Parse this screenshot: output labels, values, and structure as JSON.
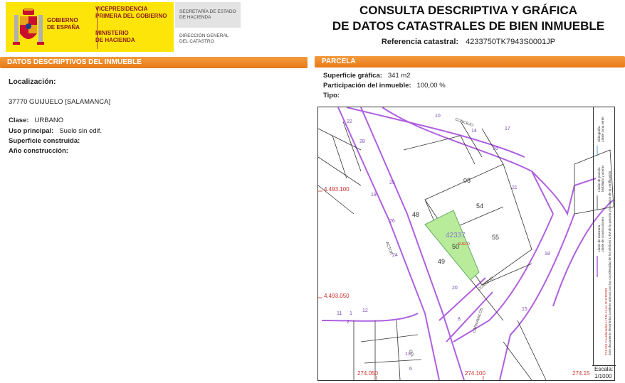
{
  "header": {
    "gov": [
      "GOBIERNO",
      "DE ESPAÑA"
    ],
    "vice": [
      "VICEPRESIDENCIA",
      "PRIMERA DEL GOBIERNO"
    ],
    "ministerio": [
      "MINISTERIO",
      "DE HACIENDA"
    ],
    "secretaria": [
      "SECRETARÍA DE ESTADO",
      "DE HACIENDA"
    ],
    "direccion": [
      "DIRECCIÓN GENERAL",
      "DEL CATASTRO"
    ],
    "title_line1": "CONSULTA DESCRIPTIVA Y GRÁFICA",
    "title_line2": "DE DATOS CATASTRALES DE BIEN INMUEBLE",
    "ref_label": "Referencia catastral:",
    "ref_value": "4233750TK7943S0001JP"
  },
  "left": {
    "section_title": "DATOS DESCRIPTIVOS DEL INMUEBLE",
    "localizacion_label": "Localización:",
    "localizacion_value": "37770 GUIJUELO [SALAMANCA]",
    "clase_label": "Clase:",
    "clase_value": "URBANO",
    "uso_label": "Uso principal:",
    "uso_value": "Suelo sin edif.",
    "superficie_label": "Superficie construida:",
    "anio_label": "Año construcción:"
  },
  "right": {
    "section_title": "PARCELA",
    "sup_label": "Superficie gráfica:",
    "sup_value": "341 m2",
    "part_label": "Participación del inmueble:",
    "part_value": "100,00 %",
    "tipo_label": "Tipo:"
  },
  "map": {
    "coords": [
      "4.493.100",
      "4.493.050",
      "274.050",
      "274.100",
      "274.15"
    ],
    "parcel_labels": [
      "08",
      "54",
      "48",
      "55",
      "49",
      "50"
    ],
    "parcel_ref": "42337",
    "parcel_small": "SUELO",
    "street_nums": [
      "10",
      "14",
      "16",
      "17",
      "19",
      "20",
      "21",
      "22",
      "24",
      "25",
      "26",
      "28",
      "11",
      "12",
      "13",
      "1",
      "6",
      "8",
      "15",
      "18",
      "2"
    ],
    "street_names": [
      "CONCEJO",
      "ACTOR",
      "CARNAVALOS",
      "DEL",
      "CONCEJO"
    ],
    "legend": [
      "Límite de manzana",
      "Límite de parcela",
      "Límite de construcciones",
      "Mobiliario y aceras",
      "Límite zona verde",
      "Hidrografía"
    ],
    "legend_note": "274.150 Coordenadas U.T.M. Huso 30 ETRS89",
    "legend_doc": "Este documento electrónico contiene anexos con las coordenadas de los vértices UTM de la parcela y los datos de la certificación",
    "scale_label": "Escala:",
    "scale_value": "1/1000"
  },
  "colors": {
    "orange": "#e87a17",
    "yellow": "#fde50a",
    "parcel": "#b8ec9a",
    "street": "#b060e0",
    "coord": "#d0302a"
  }
}
